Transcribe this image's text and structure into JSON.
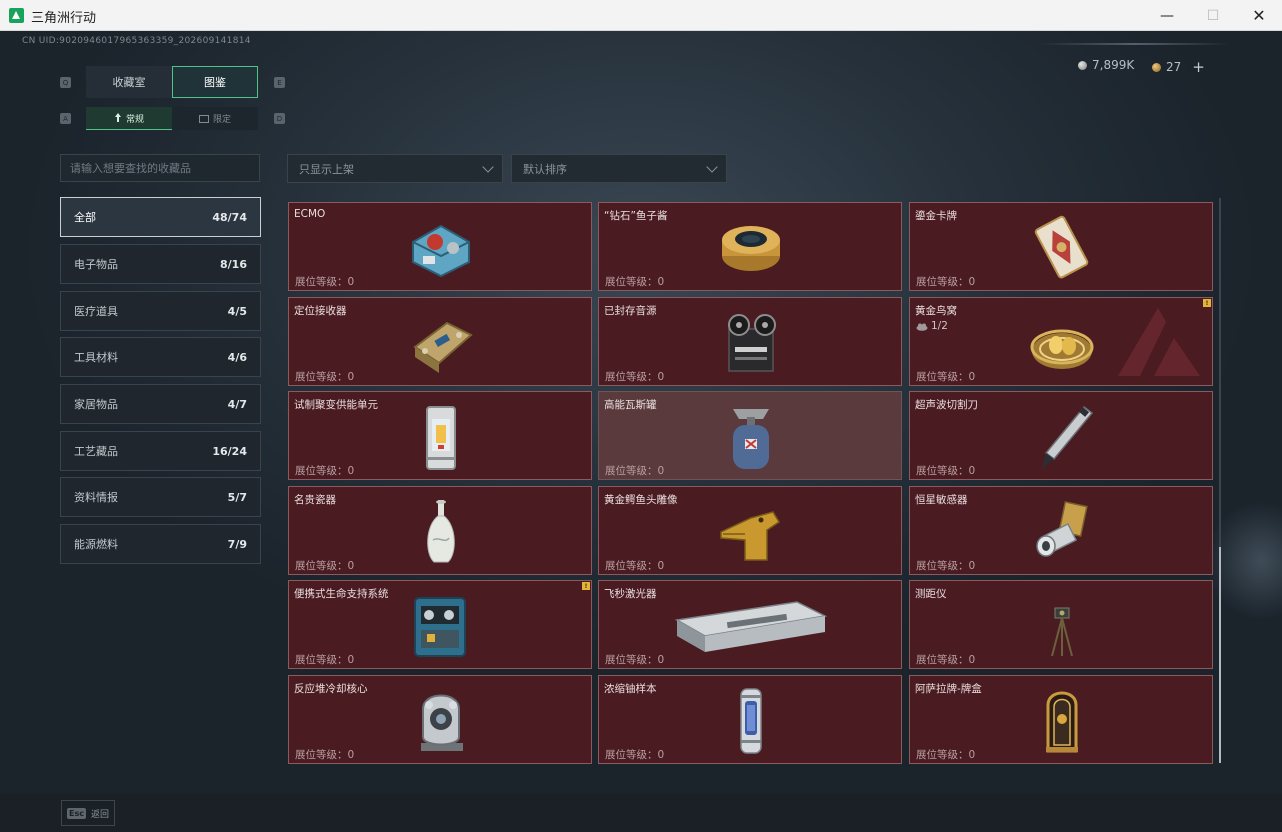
{
  "window": {
    "title": "三角洲行动",
    "minimize_label": "—",
    "maximize_label": "☐",
    "close_label": "✕"
  },
  "uid": "CN UID:9020946017965363359_202609141814",
  "currency": {
    "silver": "7,899K",
    "gold": "27",
    "add_label": "+"
  },
  "keyhints": {
    "q": "Q",
    "e": "E",
    "a": "A",
    "d": "D"
  },
  "tabs_main": [
    {
      "label": "收藏室",
      "active": false
    },
    {
      "label": "图鉴",
      "active": true
    }
  ],
  "tabs_sub": [
    {
      "label": "常规",
      "icon": "pin-icon",
      "active": true
    },
    {
      "label": "限定",
      "icon": "ticket-icon",
      "active": false
    }
  ],
  "search": {
    "placeholder": "请输入想要查找的收藏品"
  },
  "filter_dropdown": {
    "value": "只显示上架"
  },
  "sort_dropdown": {
    "value": "默认排序"
  },
  "categories": [
    {
      "label": "全部",
      "count": "48/74",
      "active": true
    },
    {
      "label": "电子物品",
      "count": "8/16"
    },
    {
      "label": "医疗道具",
      "count": "4/5"
    },
    {
      "label": "工具材料",
      "count": "4/6"
    },
    {
      "label": "家居物品",
      "count": "4/7"
    },
    {
      "label": "工艺藏品",
      "count": "16/24"
    },
    {
      "label": "资料情报",
      "count": "5/7"
    },
    {
      "label": "能源燃料",
      "count": "7/9"
    }
  ],
  "items": [
    {
      "name": "ECMO",
      "level": "展位等级：0",
      "icon": "ecmo-machine-icon"
    },
    {
      "name": "“钻石”鱼子酱",
      "level": "展位等级：0",
      "icon": "caviar-tin-icon"
    },
    {
      "name": "鎏金卡牌",
      "level": "展位等级：0",
      "icon": "gilded-card-icon"
    },
    {
      "name": "定位接收器",
      "level": "展位等级：0",
      "icon": "gps-receiver-icon"
    },
    {
      "name": "已封存音源",
      "level": "展位等级：0",
      "icon": "reel-recorder-icon"
    },
    {
      "name": "黄金鸟窝",
      "level": "展位等级：0",
      "icon": "golden-nest-icon",
      "progress": "1/2",
      "badge": "!"
    },
    {
      "name": "试制聚变供能单元",
      "level": "展位等级：0",
      "icon": "fusion-cell-icon"
    },
    {
      "name": "高能瓦斯罐",
      "level": "展位等级：0",
      "icon": "gas-canister-icon",
      "highlighted": true
    },
    {
      "name": "超声波切割刀",
      "level": "展位等级：0",
      "icon": "ultrasonic-cutter-icon"
    },
    {
      "name": "名贵瓷器",
      "level": "展位等级：0",
      "icon": "porcelain-vase-icon"
    },
    {
      "name": "黄金鳄鱼头雕像",
      "level": "展位等级：0",
      "icon": "golden-crocodile-icon"
    },
    {
      "name": "恒星敏感器",
      "level": "展位等级：0",
      "icon": "star-sensor-icon"
    },
    {
      "name": "便携式生命支持系统",
      "level": "展位等级：0",
      "icon": "life-support-icon",
      "badge": "!"
    },
    {
      "name": "飞秒激光器",
      "level": "展位等级：0",
      "icon": "femtosecond-laser-icon"
    },
    {
      "name": "测距仪",
      "level": "展位等级：0",
      "icon": "rangefinder-icon"
    },
    {
      "name": "反应堆冷却核心",
      "level": "展位等级：0",
      "icon": "reactor-core-icon"
    },
    {
      "name": "浓缩铀样本",
      "level": "展位等级：0",
      "icon": "uranium-sample-icon"
    },
    {
      "name": "阿萨拉牌-牌盒",
      "level": "展位等级：0",
      "icon": "card-case-icon"
    }
  ],
  "bottom": {
    "esc_key": "Esc",
    "back_label": "返回"
  },
  "colors": {
    "accent": "#4fc38a",
    "card_bg": "#4a1c22",
    "card_border": "#8a5a5f",
    "badge": "#e2b43b"
  }
}
